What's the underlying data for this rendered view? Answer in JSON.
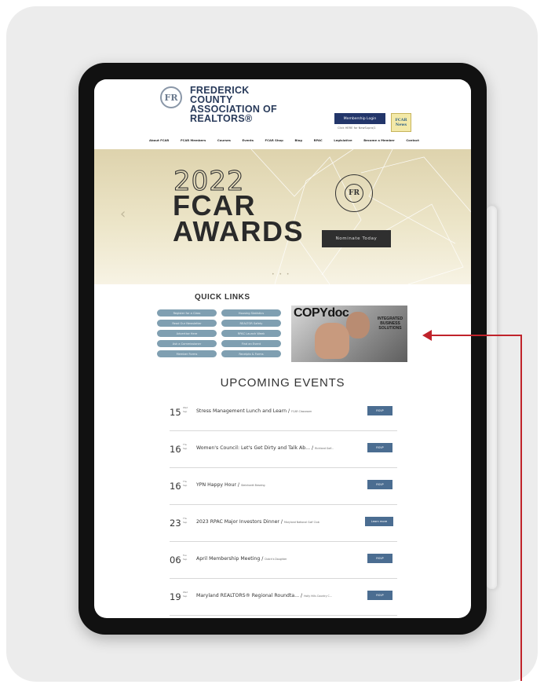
{
  "header": {
    "org_name": "FREDERICK\nCOUNTY\nASSOCIATION OF\nREALTORS®",
    "logo_text": "FR",
    "login_button": "Membership Login",
    "login_sub": "Click HERE for NewSupra/1",
    "news_badge": "FCAR\nNews"
  },
  "nav": [
    "About FCAR",
    "FCAR Members",
    "Courses",
    "Events",
    "FCAR Shop",
    "Blog",
    "RPAC",
    "Legislative",
    "Become a Member",
    "Contact"
  ],
  "hero": {
    "year": "2022",
    "title": "FCAR\nAWARDS",
    "seal_text": "FR",
    "cta": "Nominate Today",
    "prev": "‹",
    "dots": "• • •"
  },
  "quick_links": {
    "title": "QUICK LINKS",
    "items": [
      "Register for a Class",
      "Housing Statistics",
      "Read Our Newsletter",
      "REALTOR Safety",
      "Advertise Here",
      "RPAC Launch Week",
      "Ask a Commissioner",
      "Find an Event",
      "Member Forms",
      "Receipts & Forms"
    ]
  },
  "ad": {
    "brand": "COPYdoc",
    "copy": "INTEGRATED\nBUSINESS\nSOLUTIONS"
  },
  "events": {
    "title": "UPCOMING EVENTS",
    "items": [
      {
        "day": "15",
        "mon": "Wed\nSep",
        "title": "Stress Management Lunch and Learn /",
        "venue": "FCAR Classroom",
        "button": "RSVP"
      },
      {
        "day": "16",
        "mon": "Thu\nSep",
        "title": "Women's Council: Let's Get Dirty and Talk Ab... /",
        "venue": "Richland Golf...",
        "button": "RSVP"
      },
      {
        "day": "16",
        "mon": "Thu\nSep",
        "title": "YPN Happy Hour /",
        "venue": "Steinhardt Brewing",
        "button": "RSVP"
      },
      {
        "day": "23",
        "mon": "Thu\nSep",
        "title": "2023 RPAC Major Investors Dinner /",
        "venue": "Maryland National Golf Club",
        "button": "Learn more"
      },
      {
        "day": "06",
        "mon": "Tue\nSep",
        "title": "April Membership Meeting /",
        "venue": "Dutch's Daughter",
        "button": "RSVP"
      },
      {
        "day": "19",
        "mon": "Wed\nSep",
        "title": "Maryland REALTORS® Regional Roundta... /",
        "venue": "Holly Hills Country C...",
        "button": "RSVP"
      }
    ]
  },
  "colors": {
    "navy": "#23366a",
    "pill": "#7f9fb1",
    "event_button": "#4b6d91",
    "annotation_arrow": "#c0232b"
  }
}
